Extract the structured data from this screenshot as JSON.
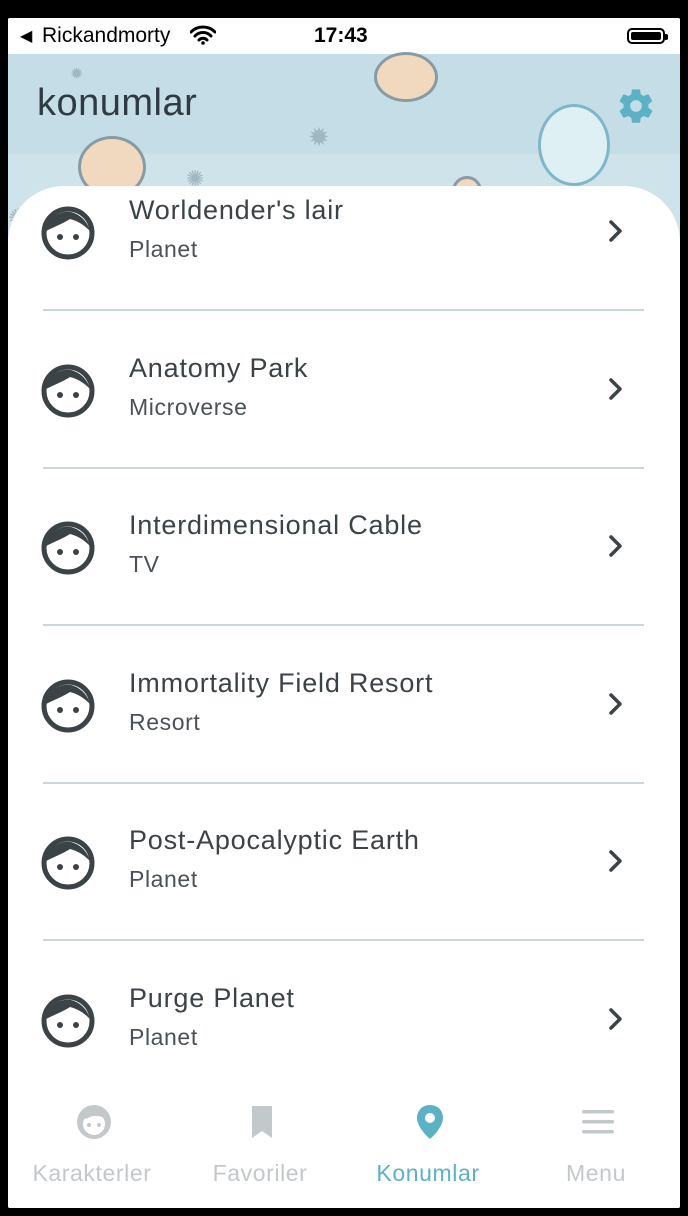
{
  "status_bar": {
    "back_glyph": "◀",
    "carrier": "Rickandmorty",
    "time": "17:43"
  },
  "header": {
    "title": "konumlar",
    "settings_icon": "gear-icon"
  },
  "locations": [
    {
      "name": "Worldender's lair",
      "type": "Planet"
    },
    {
      "name": "Anatomy Park",
      "type": "Microverse"
    },
    {
      "name": "Interdimensional Cable",
      "type": "TV"
    },
    {
      "name": "Immortality Field Resort",
      "type": "Resort"
    },
    {
      "name": "Post-Apocalyptic Earth",
      "type": "Planet"
    },
    {
      "name": "Purge Planet",
      "type": "Planet"
    }
  ],
  "bottom_nav": {
    "items": [
      {
        "label": "Karakterler",
        "icon": "face-icon"
      },
      {
        "label": "Favoriler",
        "icon": "bookmark-icon"
      },
      {
        "label": "Konumlar",
        "icon": "location-pin-icon",
        "active": true
      },
      {
        "label": "Menu",
        "icon": "menu-icon"
      }
    ]
  },
  "colors": {
    "accent": "#5cb2c4",
    "inactive": "#c3c8ca",
    "header_bg": "#cfe3ea",
    "text_dark": "#3b4347"
  }
}
